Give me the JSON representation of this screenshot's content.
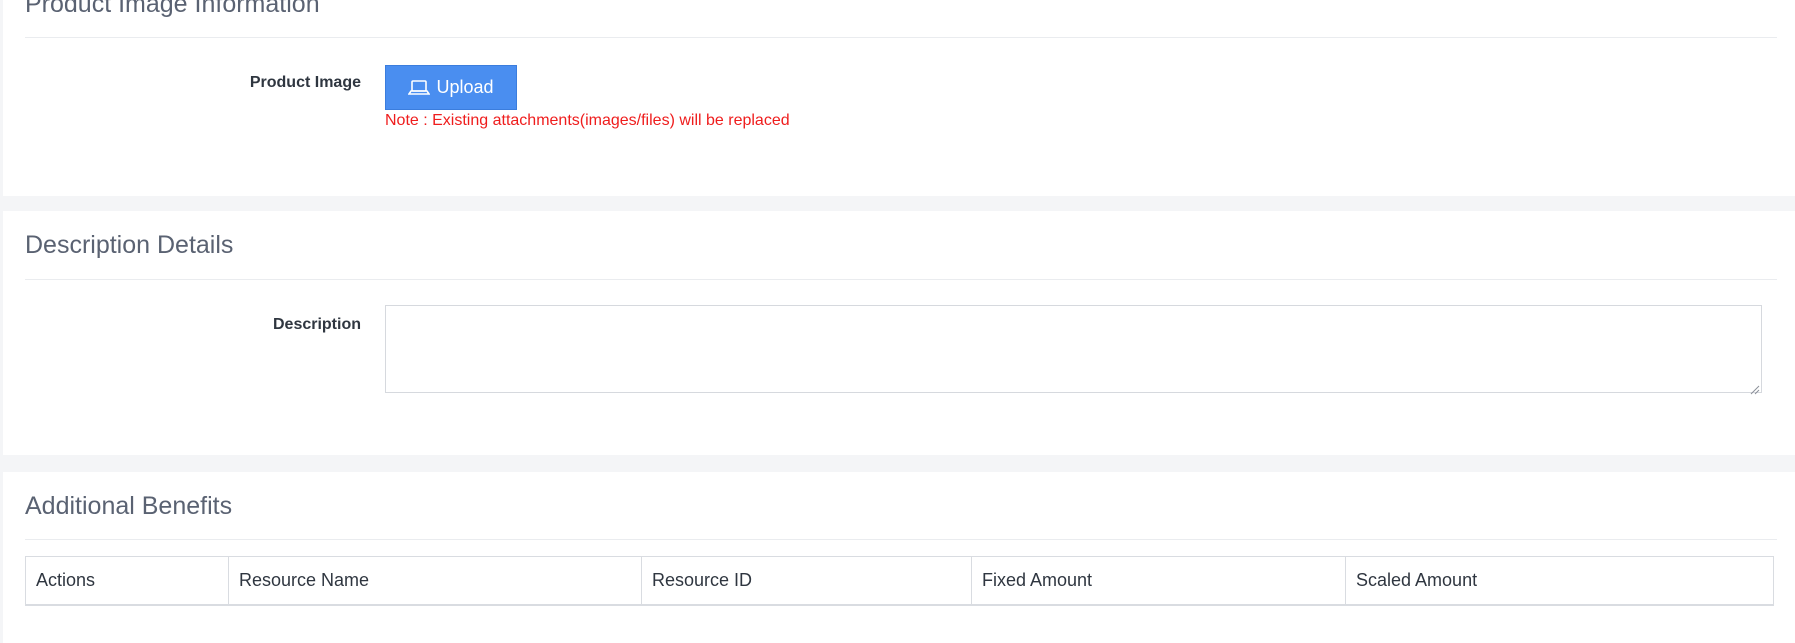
{
  "image_section": {
    "title": "Product Image Information",
    "field_label": "Product Image",
    "upload_button": {
      "icon": "laptop-icon",
      "label": "Upload"
    },
    "note": "Note : Existing attachments(images/files) will be replaced"
  },
  "description_section": {
    "title": "Description Details",
    "field_label": "Description",
    "value": ""
  },
  "benefits_section": {
    "title": "Additional Benefits",
    "columns": [
      "Actions",
      "Resource Name",
      "Resource ID",
      "Fixed Amount",
      "Scaled Amount"
    ]
  },
  "colors": {
    "primary_button": "#4a8ef0",
    "note_text": "#ef1d1d",
    "section_title": "#5a6272"
  }
}
